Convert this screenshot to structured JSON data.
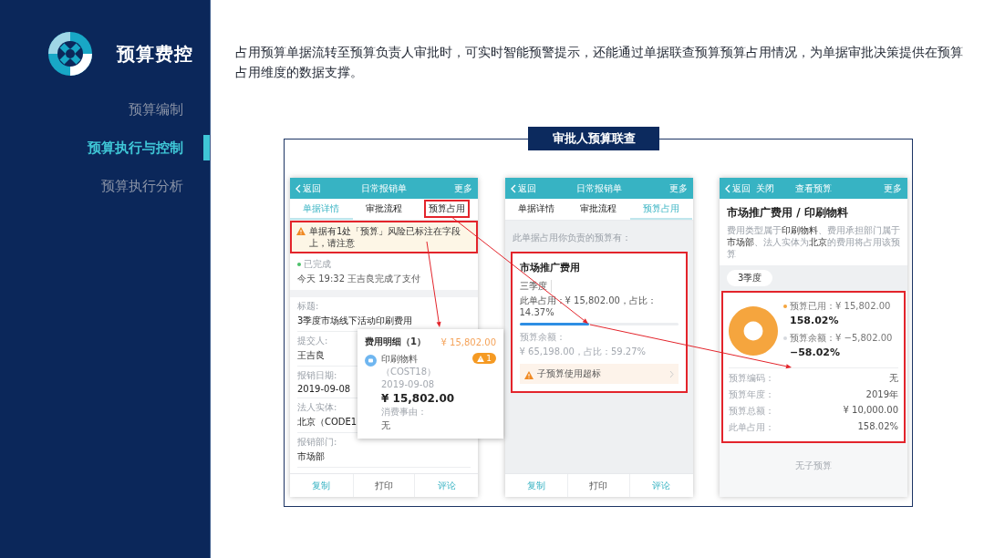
{
  "sidebar": {
    "title": "预算费控",
    "items": [
      {
        "label": "预算编制",
        "selected": false
      },
      {
        "label": "预算执行与控制",
        "selected": true
      },
      {
        "label": "预算执行分析",
        "selected": false
      }
    ]
  },
  "intro": "占用预算单据流转至预算负责人审批时，可实时智能预警提示，还能通过单据联查预算预算占用情况，为单据审批决策提供在预算占用维度的数据支撑。",
  "figure": {
    "title": "审批人预算联查",
    "phones": [
      {
        "kind": "detail",
        "nav": {
          "back": "返回",
          "title": "日常报销单",
          "more": "更多"
        },
        "tabs": [
          {
            "label": "单据详情",
            "selected": true,
            "highlighted": false
          },
          {
            "label": "审批流程",
            "selected": false,
            "highlighted": false
          },
          {
            "label": "预算占用",
            "selected": false,
            "highlighted": true
          }
        ],
        "warning": {
          "text": "单据有1处「预算」风险已标注在字段上，请注意",
          "highlighted": true
        },
        "status": {
          "label": "已完成",
          "note": "今天 19:32 王吉良完成了支付"
        },
        "fields": [
          {
            "label": "标题:",
            "value": "3季度市场线下活动印刷费用"
          },
          {
            "label": "提交人:",
            "value": "王吉良"
          },
          {
            "label": "报销日期:",
            "value": "2019-09-08"
          },
          {
            "label": "法人实体:",
            "value": "北京（CODE1"
          },
          {
            "label": "报销部门:",
            "value": "市场部"
          }
        ],
        "actions": [
          "复制",
          "打印",
          "评论"
        ]
      },
      {
        "kind": "budget_use",
        "nav": {
          "back": "返回",
          "title": "日常报销单",
          "more": "更多"
        },
        "tabs": [
          {
            "label": "单据详情",
            "selected": false,
            "highlighted": false
          },
          {
            "label": "审批流程",
            "selected": false,
            "highlighted": false
          },
          {
            "label": "预算占用",
            "selected": true,
            "highlighted": false
          }
        ],
        "intro": "此单据占用你负责的预算有：",
        "card": {
          "highlighted": true,
          "title": "市场推广费用",
          "period": "三季度",
          "usage": "此单占用：¥ 15,802.00，占比：14.37%",
          "level": 0.44,
          "remaining_label": "预算余额：",
          "remaining_value": "¥ 65,198.00，占比：59.27%",
          "alert": "子预算使用超标"
        },
        "actions": [
          "复制",
          "打印",
          "评论"
        ]
      },
      {
        "kind": "budget_view",
        "nav": {
          "back": "返回",
          "close": "关闭",
          "title": "查看预算",
          "more": "更多"
        },
        "heading": "市场推广费用 / 印刷物料",
        "description": "费用类型属于**印刷物料**、费用承担部门属于**市场部**、法人实体为**北京**的费用将占用该预算",
        "period": "3季度",
        "card": {
          "highlighted": true,
          "legend": [
            {
              "label": "预算已用：¥ 15,802.00",
              "percent": "158.02%",
              "color": "#f5a53e"
            },
            {
              "label": "预算余额：¥ −5,802.00",
              "percent": "−58.02%",
              "color": "#d6d9de"
            }
          ],
          "details": [
            {
              "label": "预算编码：",
              "value": "无"
            },
            {
              "label": "预算年度：",
              "value": "2019年"
            },
            {
              "label": "预算总额：",
              "value": "¥ 10,000.00"
            },
            {
              "label": "此单占用：",
              "value": "158.02%"
            }
          ]
        },
        "footer_note": "无子预算"
      }
    ],
    "popup": {
      "title": "费用明细（1）",
      "total": "¥ 15,802.00",
      "name": "印刷物料",
      "code": "（COST18）",
      "date": "2019-09-08",
      "amount": "¥ 15,802.00",
      "reason_label": "消费事由：",
      "reason": "无",
      "alerts": "1"
    }
  }
}
